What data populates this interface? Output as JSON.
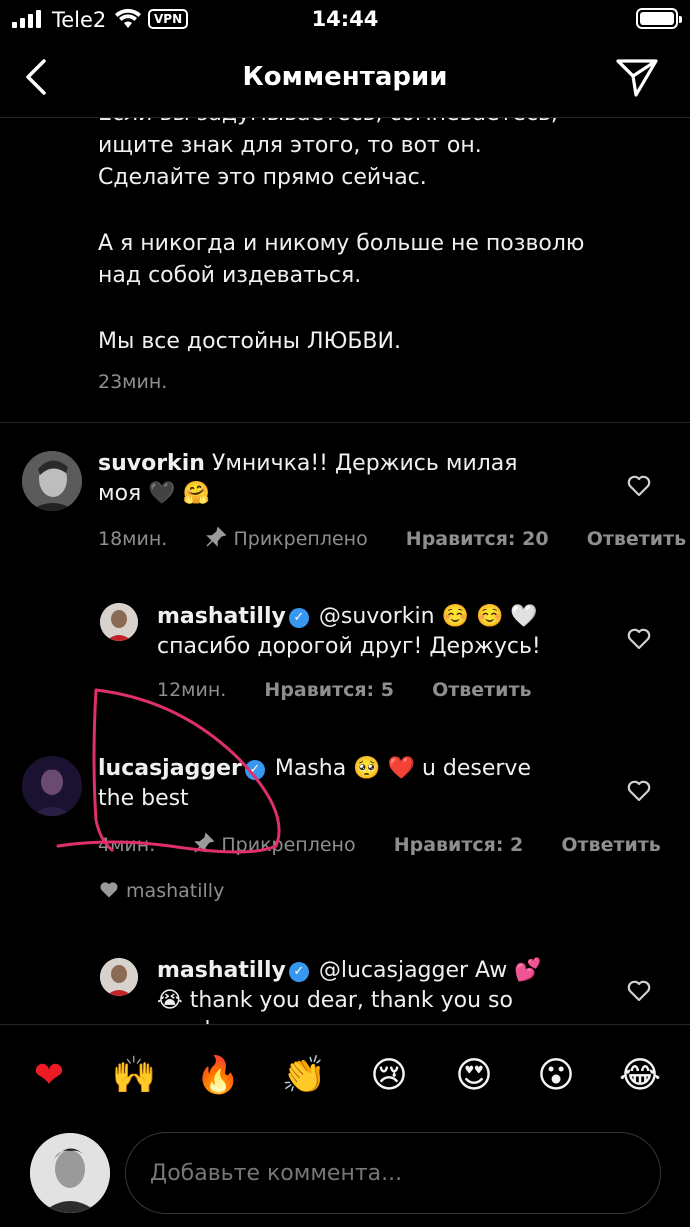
{
  "status_bar": {
    "carrier": "Tele2",
    "vpn": "VPN",
    "time": "14:44"
  },
  "header": {
    "title": "Комментарии"
  },
  "post": {
    "lines": [
      "Если вы задумываетесь, сомневаетесь,",
      "ищите знак для этого, то вот он.",
      "Сделайте это прямо сейчас.",
      "А я никогда и никому больше не позволю",
      "над собой издеваться.",
      "Мы все достойны ЛЮБВИ."
    ],
    "time": "23мин."
  },
  "comments": [
    {
      "user": "suvorkin",
      "text_line1": "Умничка!! Держись милая",
      "text_line2": "моя 🖤 🤗",
      "time": "18мин.",
      "pinned": "Прикреплено",
      "likes": "Нравится: 20",
      "reply": "Ответить"
    },
    {
      "user": "mashatilly",
      "text_line1": "@suvorkin ☺️ ☺️ 🤍",
      "text_line2": "спасибо дорогой друг! Держусь!",
      "time": "12мин.",
      "likes": "Нравится: 5",
      "reply": "Ответить"
    },
    {
      "user": "lucasjagger",
      "text_line1": "Masha 🥺 ❤️ u deserve",
      "text_line2": "the best",
      "time": "4мин.",
      "pinned": "Прикреплено",
      "likes": "Нравится: 2",
      "reply": "Ответить",
      "liked_by": "mashatilly"
    },
    {
      "user": "mashatilly",
      "text_line1": "@lucasjagger Aw 💕",
      "text_line2": "😭 thank you dear, thank you so",
      "text_line3": "much"
    }
  ],
  "emoji_bar": [
    "❤",
    "🙌",
    "🔥",
    "👏",
    "😢",
    "😍",
    "😮",
    "😂"
  ],
  "input": {
    "placeholder": "Добавьте коммента..."
  },
  "colors": {
    "background": "#000000",
    "verified": "#3897f0",
    "muted": "#8e8e8e",
    "scribble": "#e0306b"
  }
}
